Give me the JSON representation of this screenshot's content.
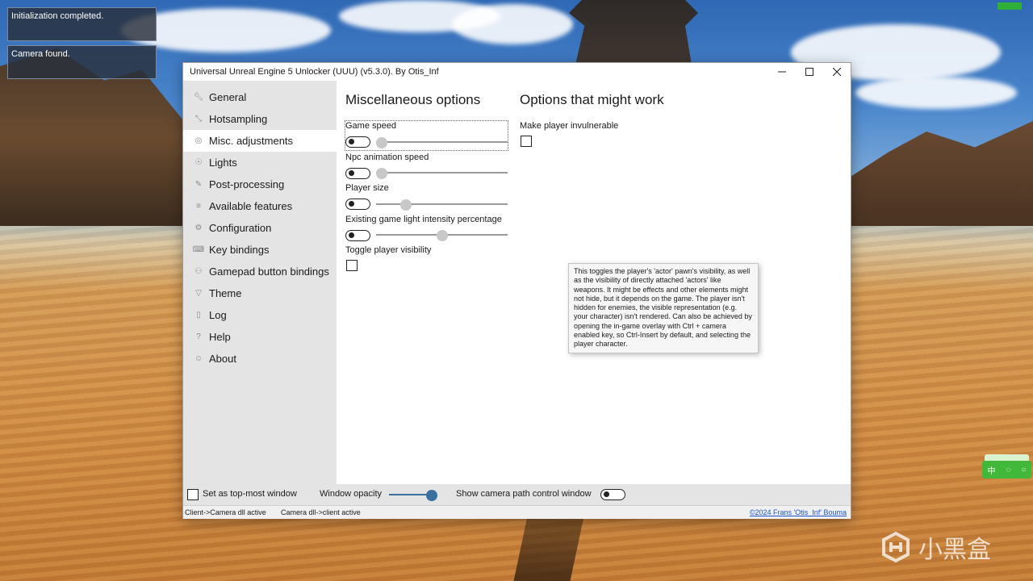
{
  "overlay": {
    "log_lines": [
      "Initialization completed.",
      "Camera found."
    ]
  },
  "window": {
    "title": "Universal Unreal Engine 5 Unlocker (UUU) (v5.3.0). By Otis_Inf",
    "controls": [
      "minimize-icon",
      "maximize-icon",
      "close-icon"
    ]
  },
  "sidebar": {
    "items": [
      {
        "label": "General",
        "icon": "wrench-icon"
      },
      {
        "label": "Hotsampling",
        "icon": "resize-icon"
      },
      {
        "label": "Misc. adjustments",
        "icon": "globe-icon"
      },
      {
        "label": "Lights",
        "icon": "lightbulb-icon"
      },
      {
        "label": "Post-processing",
        "icon": "brush-icon"
      },
      {
        "label": "Available features",
        "icon": "list-icon"
      },
      {
        "label": "Configuration",
        "icon": "gear-icon"
      },
      {
        "label": "Key bindings",
        "icon": "keyboard-icon"
      },
      {
        "label": "Gamepad button bindings",
        "icon": "gamepad-icon"
      },
      {
        "label": "Theme",
        "icon": "paint-bucket-icon"
      },
      {
        "label": "Log",
        "icon": "document-icon"
      },
      {
        "label": "Help",
        "icon": "question-icon"
      },
      {
        "label": "About",
        "icon": "person-icon"
      }
    ],
    "active_index": 2
  },
  "misc": {
    "title": "Miscellaneous options",
    "options": [
      {
        "label": "Game speed",
        "enabled": false,
        "slider_value": 0.0
      },
      {
        "label": "Npc animation speed",
        "enabled": false,
        "slider_value": 0.0
      },
      {
        "label": "Player size",
        "enabled": false,
        "slider_value": 0.23
      },
      {
        "label": "Existing game light intensity percentage",
        "enabled": false,
        "slider_value": 0.5
      }
    ],
    "visibility_label": "Toggle player visibility",
    "visibility_checked": false
  },
  "might_work": {
    "title": "Options that might work",
    "invulnerable_label": "Make player invulnerable",
    "invulnerable_checked": false
  },
  "tooltip": {
    "text": "This toggles the player's 'actor' pawn's visibility, as well as the visibility of directly attached 'actors' like weapons. It might be effects and other elements might not hide, but it depends on the game. The player isn't hidden for enemies, the visible representation (e.g. your character) isn't rendered. Can also be achieved by opening the in-game overlay with Ctrl + camera enabled key, so Ctrl-Insert by default, and selecting the player character."
  },
  "bottom": {
    "topmost_label": "Set as top-most window",
    "topmost_checked": false,
    "opacity_label": "Window opacity",
    "opacity_value": 1.0,
    "camera_path_label": "Show camera path control window",
    "camera_path_enabled": false
  },
  "status": {
    "client_to_camera": "Client->Camera dll active",
    "camera_to_client": "Camera dll->client active",
    "copyright": "©2024 Frans 'Otis_Inf' Bouma"
  },
  "ime": {
    "labels": [
      "中",
      "◌",
      "○"
    ]
  },
  "watermark": {
    "text": "小黑盒"
  },
  "colors": {
    "sidebar_bg": "#e4e4e4",
    "accent_link": "#1a55cc",
    "ime_green": "#42b83a",
    "fps_green": "#2fae38"
  }
}
